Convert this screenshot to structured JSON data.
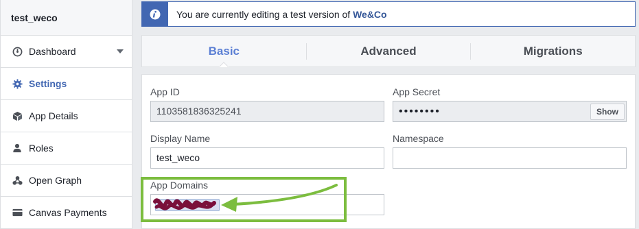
{
  "sidebar": {
    "app_name": "test_weco",
    "items": [
      {
        "label": "Dashboard",
        "icon": "dashboard-icon"
      },
      {
        "label": "Settings",
        "icon": "gear-icon",
        "active": true
      },
      {
        "label": "App Details",
        "icon": "box-icon"
      },
      {
        "label": "Roles",
        "icon": "person-icon"
      },
      {
        "label": "Open Graph",
        "icon": "graph-nodes-icon"
      },
      {
        "label": "Canvas Payments",
        "icon": "card-icon"
      }
    ]
  },
  "banner": {
    "icon": "info-icon",
    "text": "You are currently editing a test version of ",
    "app_link": "We&Co"
  },
  "tabs": [
    {
      "label": "Basic",
      "active": true
    },
    {
      "label": "Advanced"
    },
    {
      "label": "Migrations"
    }
  ],
  "form": {
    "app_id_label": "App ID",
    "app_id_value": "1103581836325241",
    "app_secret_label": "App Secret",
    "app_secret_value": "••••••••",
    "show_label": "Show",
    "display_name_label": "Display Name",
    "display_name_value": "test_weco",
    "namespace_label": "Namespace",
    "namespace_value": "",
    "app_domains_label": "App Domains"
  },
  "colors": {
    "accent": "#4267b2",
    "annotation_green": "#7cbd3f",
    "scribble": "#7a0f3a"
  }
}
